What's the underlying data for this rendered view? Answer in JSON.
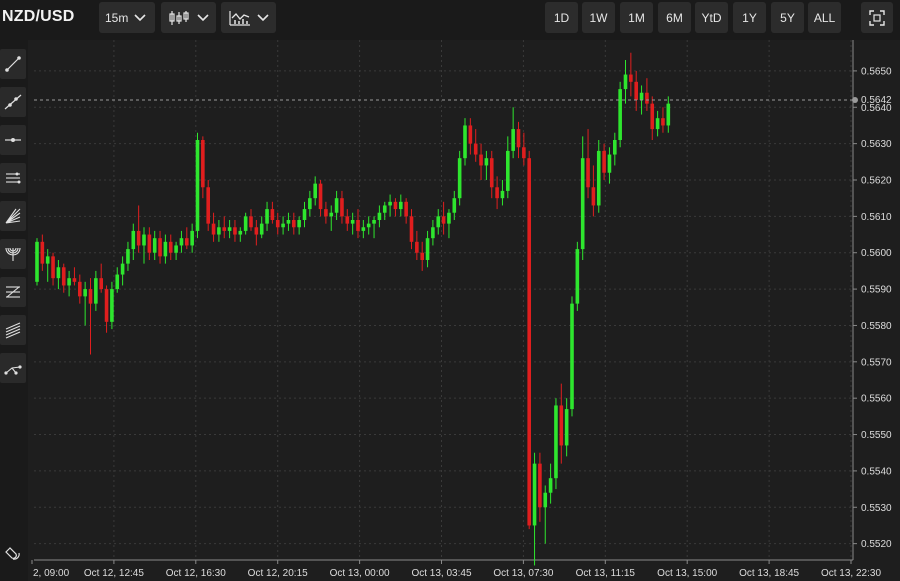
{
  "header": {
    "symbol": "NZD/USD",
    "interval": "15m",
    "chart_type_icon": "candlestick-icon",
    "indicators_icon": "indicators-icon",
    "ranges": [
      "1D",
      "1W",
      "1M",
      "6M",
      "YtD",
      "1Y",
      "5Y",
      "ALL"
    ],
    "fullscreen_icon": "fullscreen-icon"
  },
  "tools": [
    "trend-line-icon",
    "extended-line-icon",
    "horizontal-line-icon",
    "parallel-channel-icon",
    "fan-icon",
    "arc-icon",
    "fib-retracement-icon",
    "fib-channel-icon",
    "pitchfork-icon"
  ],
  "magnet_icon": "magnet-icon",
  "colors": {
    "up": "#2ee62e",
    "down": "#e01e1e",
    "background": "#1e1e1e",
    "grid": "#3a3a3a"
  },
  "chart_data": {
    "type": "candlestick",
    "title": "",
    "y_ticks": [
      "0.5650",
      "0.5640",
      "0.5630",
      "0.5620",
      "0.5610",
      "0.5600",
      "0.5590",
      "0.5580",
      "0.5570",
      "0.5560",
      "0.5550",
      "0.5540",
      "0.5530",
      "0.5520"
    ],
    "ylim": [
      0.55155,
      0.56585
    ],
    "last_price": "0.5642",
    "x_ticks": [
      "2, 09:00",
      "Oct 12, 12:45",
      "Oct 12, 16:30",
      "Oct 12, 20:15",
      "Oct 13, 00:00",
      "Oct 13, 03:45",
      "Oct 13, 07:30",
      "Oct 13, 11:15",
      "Oct 13, 15:00",
      "Oct 13, 18:45",
      "Oct 13, 22:30"
    ],
    "ohlc": [
      [
        0.5592,
        0.5604,
        0.5591,
        0.5603
      ],
      [
        0.5603,
        0.5605,
        0.5595,
        0.5597
      ],
      [
        0.5597,
        0.5601,
        0.5592,
        0.5599
      ],
      [
        0.5599,
        0.56,
        0.5591,
        0.5593
      ],
      [
        0.5593,
        0.5598,
        0.559,
        0.5596
      ],
      [
        0.5596,
        0.5597,
        0.5589,
        0.5591
      ],
      [
        0.5591,
        0.5595,
        0.5588,
        0.5593
      ],
      [
        0.5593,
        0.5596,
        0.5591,
        0.5592
      ],
      [
        0.5592,
        0.5594,
        0.5586,
        0.5588
      ],
      [
        0.5588,
        0.5592,
        0.558,
        0.559
      ],
      [
        0.559,
        0.5593,
        0.5572,
        0.5586
      ],
      [
        0.5586,
        0.5595,
        0.5584,
        0.5593
      ],
      [
        0.5593,
        0.5597,
        0.5589,
        0.559
      ],
      [
        0.559,
        0.5591,
        0.5578,
        0.5581
      ],
      [
        0.5581,
        0.5592,
        0.5579,
        0.559
      ],
      [
        0.559,
        0.5596,
        0.5589,
        0.5594
      ],
      [
        0.5594,
        0.5599,
        0.5591,
        0.5597
      ],
      [
        0.5597,
        0.5603,
        0.5595,
        0.5601
      ],
      [
        0.5601,
        0.5608,
        0.5598,
        0.5606
      ],
      [
        0.5606,
        0.5613,
        0.56,
        0.5602
      ],
      [
        0.5602,
        0.5607,
        0.5597,
        0.5605
      ],
      [
        0.5605,
        0.5607,
        0.5598,
        0.56
      ],
      [
        0.56,
        0.5606,
        0.5598,
        0.5604
      ],
      [
        0.5604,
        0.5606,
        0.5597,
        0.5599
      ],
      [
        0.5599,
        0.5605,
        0.5597,
        0.5603
      ],
      [
        0.5603,
        0.5605,
        0.5598,
        0.56
      ],
      [
        0.56,
        0.5603,
        0.5598,
        0.5602
      ],
      [
        0.5602,
        0.5606,
        0.56,
        0.5604
      ],
      [
        0.5604,
        0.5607,
        0.5601,
        0.5602
      ],
      [
        0.5602,
        0.5608,
        0.56,
        0.5606
      ],
      [
        0.5606,
        0.5633,
        0.5604,
        0.5631
      ],
      [
        0.5631,
        0.5632,
        0.5615,
        0.5618
      ],
      [
        0.5618,
        0.562,
        0.5606,
        0.5608
      ],
      [
        0.5608,
        0.5611,
        0.5603,
        0.5605
      ],
      [
        0.5605,
        0.5609,
        0.5603,
        0.5607
      ],
      [
        0.5607,
        0.561,
        0.5604,
        0.5606
      ],
      [
        0.5606,
        0.5609,
        0.5604,
        0.5607
      ],
      [
        0.5607,
        0.5609,
        0.5603,
        0.5605
      ],
      [
        0.5605,
        0.5607,
        0.5603,
        0.5606
      ],
      [
        0.5606,
        0.5611,
        0.5605,
        0.561
      ],
      [
        0.561,
        0.5612,
        0.5606,
        0.5607
      ],
      [
        0.5607,
        0.5609,
        0.5602,
        0.5605
      ],
      [
        0.5605,
        0.561,
        0.5604,
        0.5608
      ],
      [
        0.5608,
        0.5614,
        0.5606,
        0.5612
      ],
      [
        0.5612,
        0.5614,
        0.5608,
        0.5609
      ],
      [
        0.5609,
        0.5611,
        0.5605,
        0.5607
      ],
      [
        0.5607,
        0.561,
        0.5605,
        0.5608
      ],
      [
        0.5608,
        0.5611,
        0.5606,
        0.5609
      ],
      [
        0.5609,
        0.5611,
        0.5605,
        0.5607
      ],
      [
        0.5607,
        0.561,
        0.5605,
        0.5609
      ],
      [
        0.5609,
        0.5614,
        0.5607,
        0.5612
      ],
      [
        0.5612,
        0.5617,
        0.561,
        0.5615
      ],
      [
        0.5615,
        0.5621,
        0.5613,
        0.5619
      ],
      [
        0.5619,
        0.562,
        0.561,
        0.5612
      ],
      [
        0.5612,
        0.5614,
        0.5608,
        0.561
      ],
      [
        0.561,
        0.5613,
        0.5606,
        0.5611
      ],
      [
        0.5611,
        0.5617,
        0.5609,
        0.5615
      ],
      [
        0.5615,
        0.5617,
        0.5608,
        0.561
      ],
      [
        0.561,
        0.5612,
        0.5606,
        0.5608
      ],
      [
        0.5608,
        0.5611,
        0.5605,
        0.5609
      ],
      [
        0.5609,
        0.5612,
        0.5604,
        0.5606
      ],
      [
        0.5606,
        0.5609,
        0.5604,
        0.5607
      ],
      [
        0.5607,
        0.561,
        0.5605,
        0.5608
      ],
      [
        0.5608,
        0.561,
        0.5604,
        0.5609
      ],
      [
        0.5609,
        0.5613,
        0.5607,
        0.5611
      ],
      [
        0.5611,
        0.5614,
        0.5609,
        0.5613
      ],
      [
        0.5613,
        0.5616,
        0.561,
        0.5614
      ],
      [
        0.5614,
        0.5615,
        0.561,
        0.5612
      ],
      [
        0.5612,
        0.5616,
        0.561,
        0.5614
      ],
      [
        0.5614,
        0.5615,
        0.5608,
        0.561
      ],
      [
        0.561,
        0.5612,
        0.5601,
        0.5603
      ],
      [
        0.5603,
        0.5606,
        0.5598,
        0.56
      ],
      [
        0.56,
        0.5603,
        0.5595,
        0.5598
      ],
      [
        0.5598,
        0.5606,
        0.5596,
        0.5604
      ],
      [
        0.5604,
        0.5609,
        0.5602,
        0.5607
      ],
      [
        0.5607,
        0.5612,
        0.5605,
        0.561
      ],
      [
        0.561,
        0.5614,
        0.5605,
        0.5608
      ],
      [
        0.5608,
        0.5612,
        0.5604,
        0.5611
      ],
      [
        0.5611,
        0.5617,
        0.5609,
        0.5615
      ],
      [
        0.5615,
        0.5628,
        0.5613,
        0.5626
      ],
      [
        0.5626,
        0.5637,
        0.5624,
        0.5635
      ],
      [
        0.5635,
        0.5637,
        0.5627,
        0.563
      ],
      [
        0.563,
        0.5634,
        0.5625,
        0.5627
      ],
      [
        0.5627,
        0.563,
        0.562,
        0.5624
      ],
      [
        0.5624,
        0.5628,
        0.562,
        0.5626
      ],
      [
        0.5626,
        0.5628,
        0.5615,
        0.5618
      ],
      [
        0.5618,
        0.5621,
        0.5612,
        0.5615
      ],
      [
        0.5615,
        0.562,
        0.5613,
        0.5617
      ],
      [
        0.5617,
        0.5632,
        0.5615,
        0.5628
      ],
      [
        0.5628,
        0.564,
        0.5626,
        0.5634
      ],
      [
        0.5634,
        0.5636,
        0.5626,
        0.5629
      ],
      [
        0.5629,
        0.5633,
        0.5624,
        0.5626
      ],
      [
        0.5626,
        0.5628,
        0.5524,
        0.5525
      ],
      [
        0.5525,
        0.5545,
        0.5514,
        0.5542
      ],
      [
        0.5542,
        0.5545,
        0.5526,
        0.553
      ],
      [
        0.553,
        0.5536,
        0.552,
        0.5534
      ],
      [
        0.5534,
        0.5542,
        0.5531,
        0.5538
      ],
      [
        0.5538,
        0.556,
        0.5535,
        0.5558
      ],
      [
        0.5558,
        0.5564,
        0.5542,
        0.5547
      ],
      [
        0.5547,
        0.556,
        0.5544,
        0.5557
      ],
      [
        0.5557,
        0.5588,
        0.5555,
        0.5586
      ],
      [
        0.5586,
        0.5603,
        0.5584,
        0.5601
      ],
      [
        0.5601,
        0.5632,
        0.5598,
        0.5626
      ],
      [
        0.5626,
        0.5634,
        0.5615,
        0.5618
      ],
      [
        0.5618,
        0.5624,
        0.561,
        0.5613
      ],
      [
        0.5613,
        0.5631,
        0.5611,
        0.5628
      ],
      [
        0.5628,
        0.563,
        0.562,
        0.5622
      ],
      [
        0.5622,
        0.5629,
        0.5619,
        0.5627
      ],
      [
        0.5627,
        0.5633,
        0.5624,
        0.5631
      ],
      [
        0.5631,
        0.5647,
        0.5629,
        0.5645
      ],
      [
        0.5645,
        0.5653,
        0.5641,
        0.5649
      ],
      [
        0.5649,
        0.5655,
        0.5643,
        0.5647
      ],
      [
        0.5647,
        0.565,
        0.5639,
        0.5642
      ],
      [
        0.5642,
        0.5646,
        0.5638,
        0.5644
      ],
      [
        0.5644,
        0.5648,
        0.5639,
        0.5641
      ],
      [
        0.5641,
        0.5643,
        0.5631,
        0.5634
      ],
      [
        0.5634,
        0.5639,
        0.5632,
        0.5637
      ],
      [
        0.5637,
        0.564,
        0.5633,
        0.5635
      ],
      [
        0.5635,
        0.5643,
        0.5633,
        0.5641
      ]
    ]
  }
}
